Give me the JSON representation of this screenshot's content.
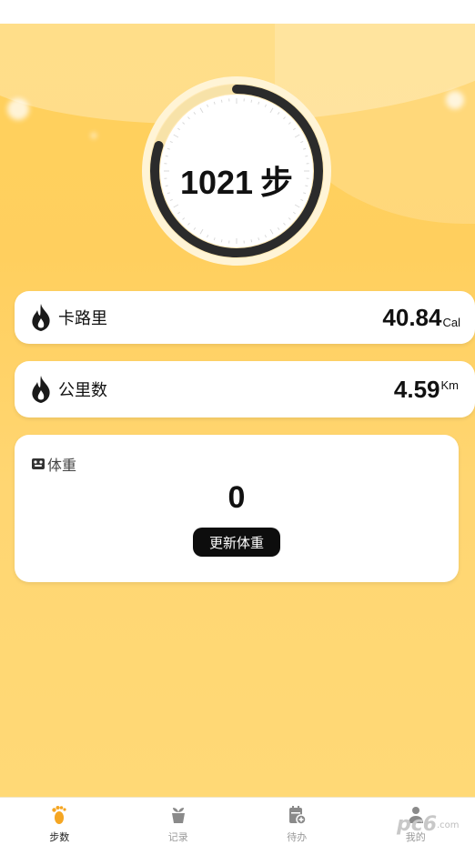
{
  "steps": {
    "value": "1021",
    "unit": "步",
    "progress_fraction": 0.8
  },
  "calories": {
    "label": "卡路里",
    "value": "40.84",
    "unit": "Cal"
  },
  "distance": {
    "label": "公里数",
    "value": "4.59",
    "unit": "Km"
  },
  "weight": {
    "label": "体重",
    "value": "0",
    "button": "更新体重"
  },
  "tabs": [
    {
      "label": "步数",
      "icon": "footprint-icon",
      "active": true
    },
    {
      "label": "记录",
      "icon": "plant-pot-icon",
      "active": false
    },
    {
      "label": "待办",
      "icon": "calendar-add-icon",
      "active": false
    },
    {
      "label": "我的",
      "icon": "person-icon",
      "active": false
    }
  ],
  "watermark": {
    "brand": "pc6",
    "domain": ".com"
  },
  "colors": {
    "background": "#ffd15c",
    "accent": "#f5a623",
    "ring": "#2b2b2b",
    "button": "#0d0d0d"
  }
}
